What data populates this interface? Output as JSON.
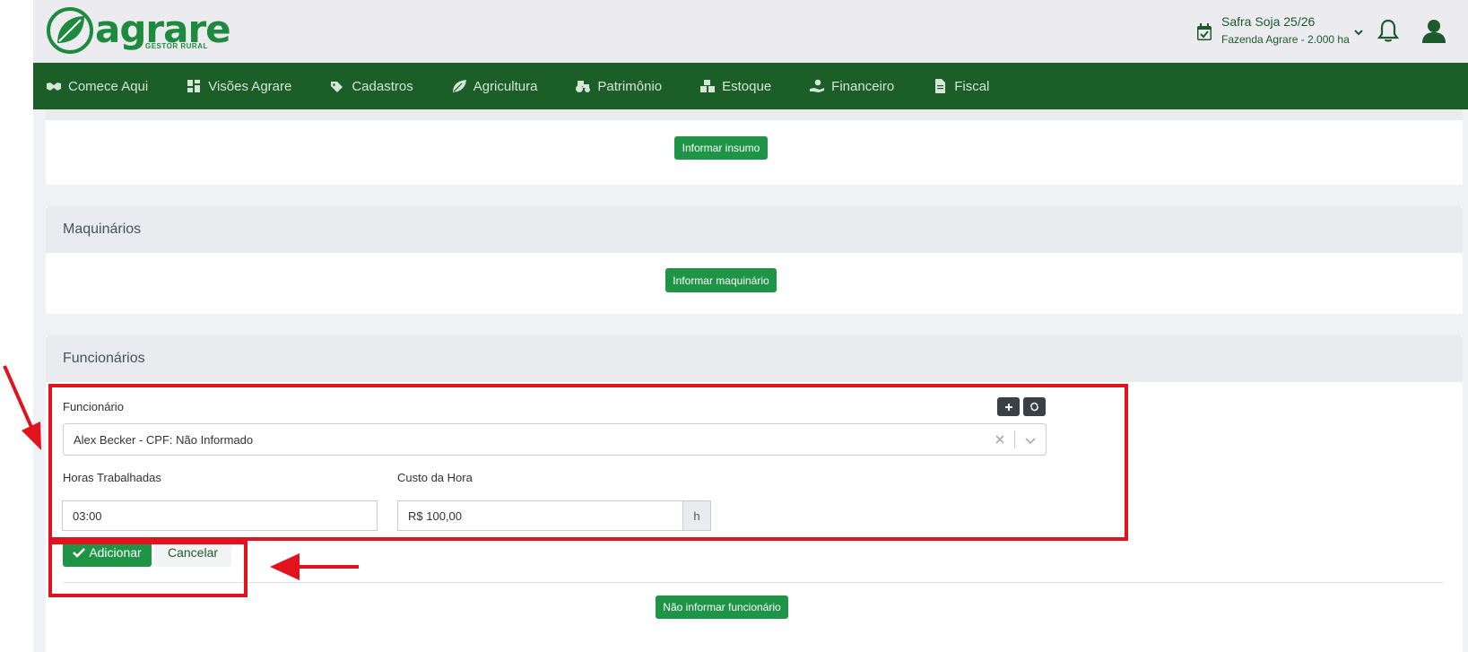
{
  "header": {
    "logo_name": "agrare",
    "logo_sub": "GESTOR RURAL",
    "season_name": "Safra Soja 25/26",
    "farm_name": "Fazenda Agrare - 2.000 ha"
  },
  "nav": {
    "items": [
      {
        "label": "Comece Aqui",
        "icon": "handshake-icon"
      },
      {
        "label": "Visões Agrare",
        "icon": "dashboard-icon"
      },
      {
        "label": "Cadastros",
        "icon": "tags-icon"
      },
      {
        "label": "Agricultura",
        "icon": "leaf-icon"
      },
      {
        "label": "Patrimônio",
        "icon": "tractor-icon"
      },
      {
        "label": "Estoque",
        "icon": "boxes-icon"
      },
      {
        "label": "Financeiro",
        "icon": "hand-money-icon"
      },
      {
        "label": "Fiscal",
        "icon": "invoice-icon"
      }
    ]
  },
  "insumos": {
    "button": "Informar insumo"
  },
  "maquinarios": {
    "title": "Maquinários",
    "button": "Informar maquinário"
  },
  "funcionarios": {
    "title": "Funcionários",
    "employee_label": "Funcionário",
    "employee_value": "Alex Becker - CPF: Não Informado",
    "hours_label": "Horas Trabalhadas",
    "hours_value": "03:00",
    "cost_label": "Custo da Hora",
    "cost_value": "R$ 100,00",
    "cost_addon": "h",
    "add_button": "Adicionar",
    "cancel_button": "Cancelar",
    "skip_button": "Não informar funcionário"
  },
  "colors": {
    "brand_green": "#1e8a3e",
    "nav_green": "#1b5e27",
    "button_green": "#1e9447",
    "annotation_red": "#e0131f"
  }
}
